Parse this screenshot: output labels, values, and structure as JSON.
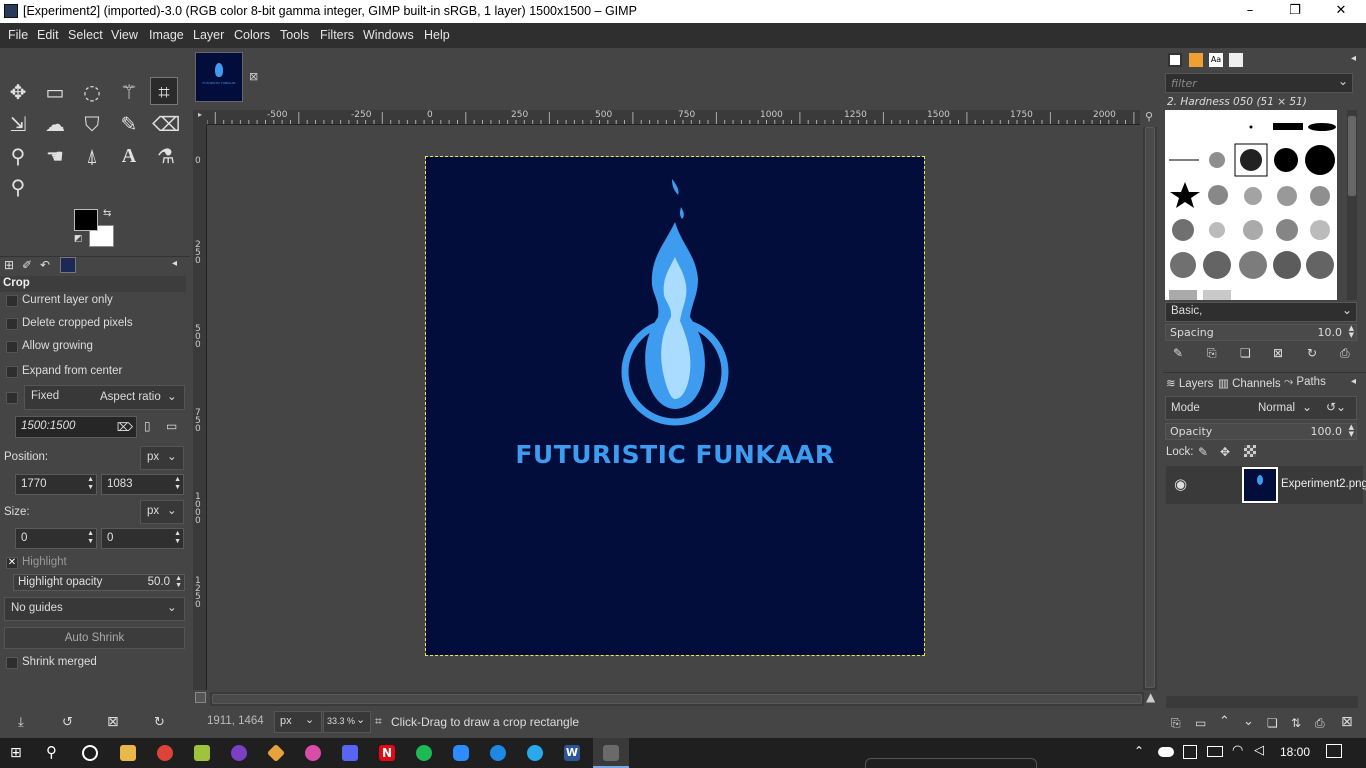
{
  "window": {
    "title": "[Experiment2] (imported)-3.0 (RGB color 8-bit gamma integer, GIMP built-in sRGB, 1 layer) 1500x1500 – GIMP",
    "minimize": "–",
    "restore": "❐",
    "close": "✕"
  },
  "menu": [
    "File",
    "Edit",
    "Select",
    "View",
    "Image",
    "Layer",
    "Colors",
    "Tools",
    "Filters",
    "Windows",
    "Help"
  ],
  "tool_options": {
    "title": "Crop",
    "current_layer_only": "Current layer only",
    "delete_cropped": "Delete cropped pixels",
    "allow_growing": "Allow growing",
    "expand_center": "Expand from center",
    "fixed": "Fixed",
    "aspect": "Aspect ratio",
    "ratio_value": "1500:1500",
    "position_label": "Position:",
    "position_unit": "px",
    "pos_x": "1770",
    "pos_y": "1083",
    "size_label": "Size:",
    "size_unit": "px",
    "size_w": "0",
    "size_h": "0",
    "highlight": "Highlight",
    "highlight_opacity_label": "Highlight opacity",
    "highlight_opacity": "50.0",
    "guides": "No guides",
    "auto_shrink": "Auto Shrink",
    "shrink_merged": "Shrink merged"
  },
  "ruler_h": [
    "-500",
    "-250",
    "0",
    "250",
    "500",
    "750",
    "1000",
    "1250",
    "1500",
    "1750",
    "2000"
  ],
  "ruler_v": [
    "0",
    "2 5 0",
    "5 0 0",
    "7 5 0",
    "1 0 0 0",
    "1 2 5 0"
  ],
  "image": {
    "logo_text": "FUTURISTIC FUNKAAR",
    "thumb_text": "FUTURISTIC FUNKAAR"
  },
  "status": {
    "coords": "1911, 1464",
    "unit": "px",
    "zoom": "33.3 %",
    "message": "Click-Drag to draw a crop rectangle"
  },
  "brushes": {
    "filter_placeholder": "filter",
    "current": "2. Hardness 050 (51 × 51)",
    "tag": "Basic,",
    "spacing_label": "Spacing",
    "spacing": "10.0"
  },
  "layers": {
    "tabs": [
      "Layers",
      "Channels",
      "Paths"
    ],
    "mode_label": "Mode",
    "mode": "Normal",
    "opacity_label": "Opacity",
    "opacity": "100.0",
    "lock_label": "Lock:",
    "layer_name": "Experiment2.png"
  },
  "taskbar": {
    "time": "18:00"
  },
  "colors": {
    "image_bg": "#020d3c",
    "logo_blue": "#3d9bf0",
    "flame_light": "#a9dcff"
  }
}
